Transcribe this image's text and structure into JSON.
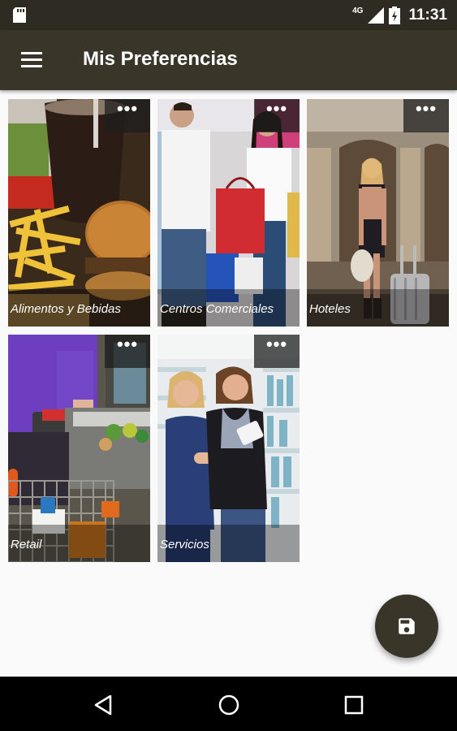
{
  "status_bar": {
    "network": "4G",
    "time": "11:31"
  },
  "app_bar": {
    "title": "Mis Preferencias",
    "menu_icon": "hamburger-menu-icon"
  },
  "categories": [
    {
      "label": "Alimentos y Bebidas",
      "more": "•••"
    },
    {
      "label": "Centros Comerciales",
      "more": "•••"
    },
    {
      "label": "Hoteles",
      "more": "•••"
    },
    {
      "label": "Retail",
      "more": "•••"
    },
    {
      "label": "Servicios",
      "more": "•••"
    }
  ],
  "fab": {
    "icon": "save-icon"
  },
  "nav": {
    "back_icon": "back-icon",
    "home_icon": "home-icon",
    "recents_icon": "recents-icon"
  },
  "colors": {
    "primary": "#393528",
    "status_bar": "#2e2c22",
    "background": "#fafafa"
  }
}
